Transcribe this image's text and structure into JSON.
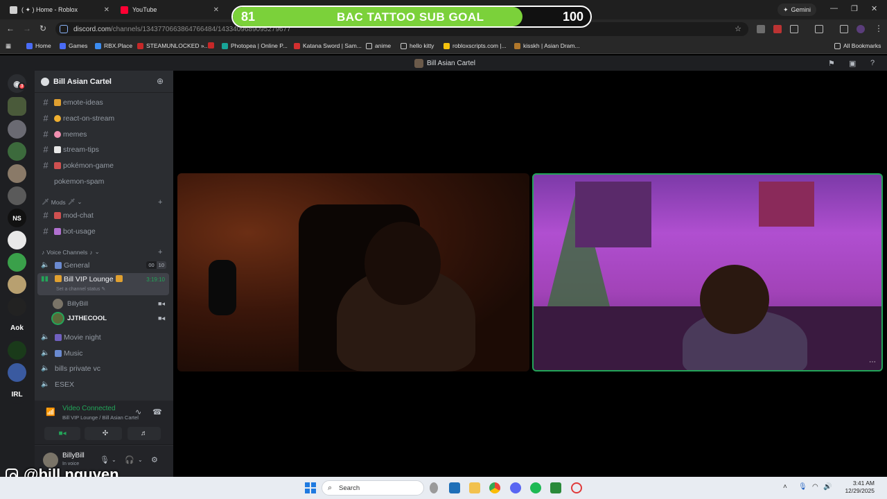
{
  "browser": {
    "tabs": [
      {
        "label": "( ✦ ) Home - Roblox"
      },
      {
        "label": "YouTube"
      }
    ],
    "gemini_label": "Gemini",
    "url_host": "discord.com",
    "url_path": "/channels/1343770663864766484/1433409689095279677",
    "bookmarks": [
      {
        "label": "Home"
      },
      {
        "label": "Games"
      },
      {
        "label": "RBX.Place"
      },
      {
        "label": "STEAMUNLOCKED »..."
      },
      {
        "label": "Photopea | Online P..."
      },
      {
        "label": "Katana Sword | Sam..."
      },
      {
        "label": "anime"
      },
      {
        "label": "hello kitty"
      },
      {
        "label": "robloxscripts.com |..."
      },
      {
        "label": "kisskh | Asian Dram..."
      }
    ],
    "all_bookmarks": "All Bookmarks"
  },
  "overlay": {
    "current": "81",
    "label": "BAC TATTOO SUB GOAL",
    "target": "100",
    "progress": 0.81,
    "fill_color": "#7bd13a"
  },
  "discord": {
    "window_title": "Bill Asian Cartel",
    "rail_badge": "3",
    "rail_text_servers": [
      "NS",
      "Aok",
      "IRL"
    ],
    "server_name": "Bill Asian Cartel",
    "channels": [
      {
        "name": "emote-ideas",
        "emoji": "trophy-emoji"
      },
      {
        "name": "react-on-stream",
        "emoji": "face-emoji"
      },
      {
        "name": "memes",
        "emoji": "pig-emoji"
      },
      {
        "name": "stream-tips",
        "emoji": "memo-emoji"
      },
      {
        "name": "pokémon-game",
        "emoji": "figure-emoji"
      },
      {
        "name": "pokemon-spam",
        "emoji": ""
      }
    ],
    "mods_category": "Mods",
    "mod_channels": [
      {
        "name": "mod-chat"
      },
      {
        "name": "bot-usage"
      }
    ],
    "voice_category": "Voice Channels",
    "voice_channels": {
      "general": {
        "name": "General",
        "count": "00",
        "limit": "10"
      },
      "vip": {
        "name": "Bill VIP Lounge",
        "timer": "3:19:10",
        "status_hint": "Set a channel status"
      },
      "users": [
        {
          "name": "BillyBill"
        },
        {
          "name": "JJTHECOOL"
        }
      ],
      "others": [
        {
          "name": "Movie night"
        },
        {
          "name": "Music"
        },
        {
          "name": "bills private vc"
        },
        {
          "name": "ESEX"
        }
      ]
    },
    "voice_panel": {
      "status": "Video Connected",
      "location": "Bill VIP Lounge / Bill Asian Cartel"
    },
    "user": {
      "name": "BillyBill",
      "status": "In voice"
    },
    "accent": "#23a559"
  },
  "watermark": "@bill.nguyen",
  "taskbar": {
    "search_placeholder": "Search",
    "time": "3:41 AM",
    "date": "12/29/2025"
  }
}
